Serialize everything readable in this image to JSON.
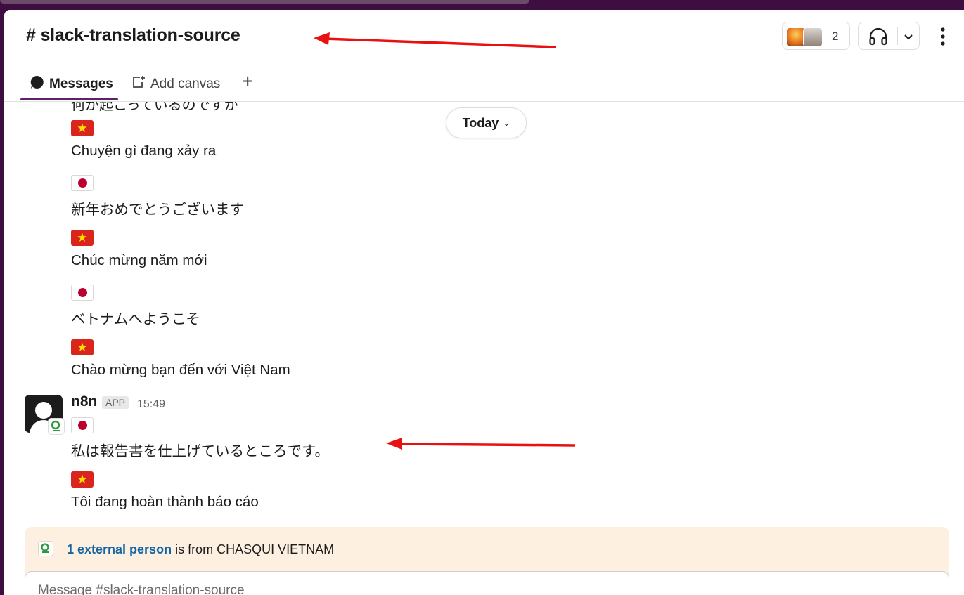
{
  "channel": {
    "title": "# slack-translation-source",
    "member_count": "2"
  },
  "tabs": [
    {
      "label": "Messages"
    },
    {
      "label": "Add canvas"
    },
    {
      "label": "+"
    }
  ],
  "date_divider": {
    "label": "Today"
  },
  "messages": {
    "cutoff_text": "何が起こっているのですか",
    "earlier_lines": [
      {
        "flag": "vn-flag",
        "text": "Chuyện gì đang xảy ra"
      },
      {
        "flag": "jp-flag",
        "text": "新年おめでとうございます"
      },
      {
        "flag": "vn-flag",
        "text": "Chúc mừng năm mới"
      },
      {
        "flag": "jp-flag",
        "text": "ベトナムへようこそ"
      },
      {
        "flag": "vn-flag",
        "text": "Chào mừng bạn đến với Việt Nam"
      }
    ],
    "latest": {
      "sender": "n8n",
      "app_tag": "APP",
      "time": "15:49",
      "lines": [
        {
          "flag": "jp-flag",
          "text": "私は報告書を仕上げているところです。"
        },
        {
          "flag": "vn-flag",
          "text": "Tôi đang hoàn thành báo cáo"
        }
      ]
    }
  },
  "external_banner": {
    "link_text": "1 external person",
    "rest_text": " is from CHASQUI VIETNAM"
  },
  "composer": {
    "placeholder": "Message #slack-translation-source"
  },
  "colors": {
    "sidebar": "#3f0e40",
    "link": "#1264a3",
    "annotation_arrow": "#e81010",
    "vn_flag": "#da251d",
    "jp_flag_disc": "#bc002d",
    "banner_bg": "#fdf0e1"
  }
}
